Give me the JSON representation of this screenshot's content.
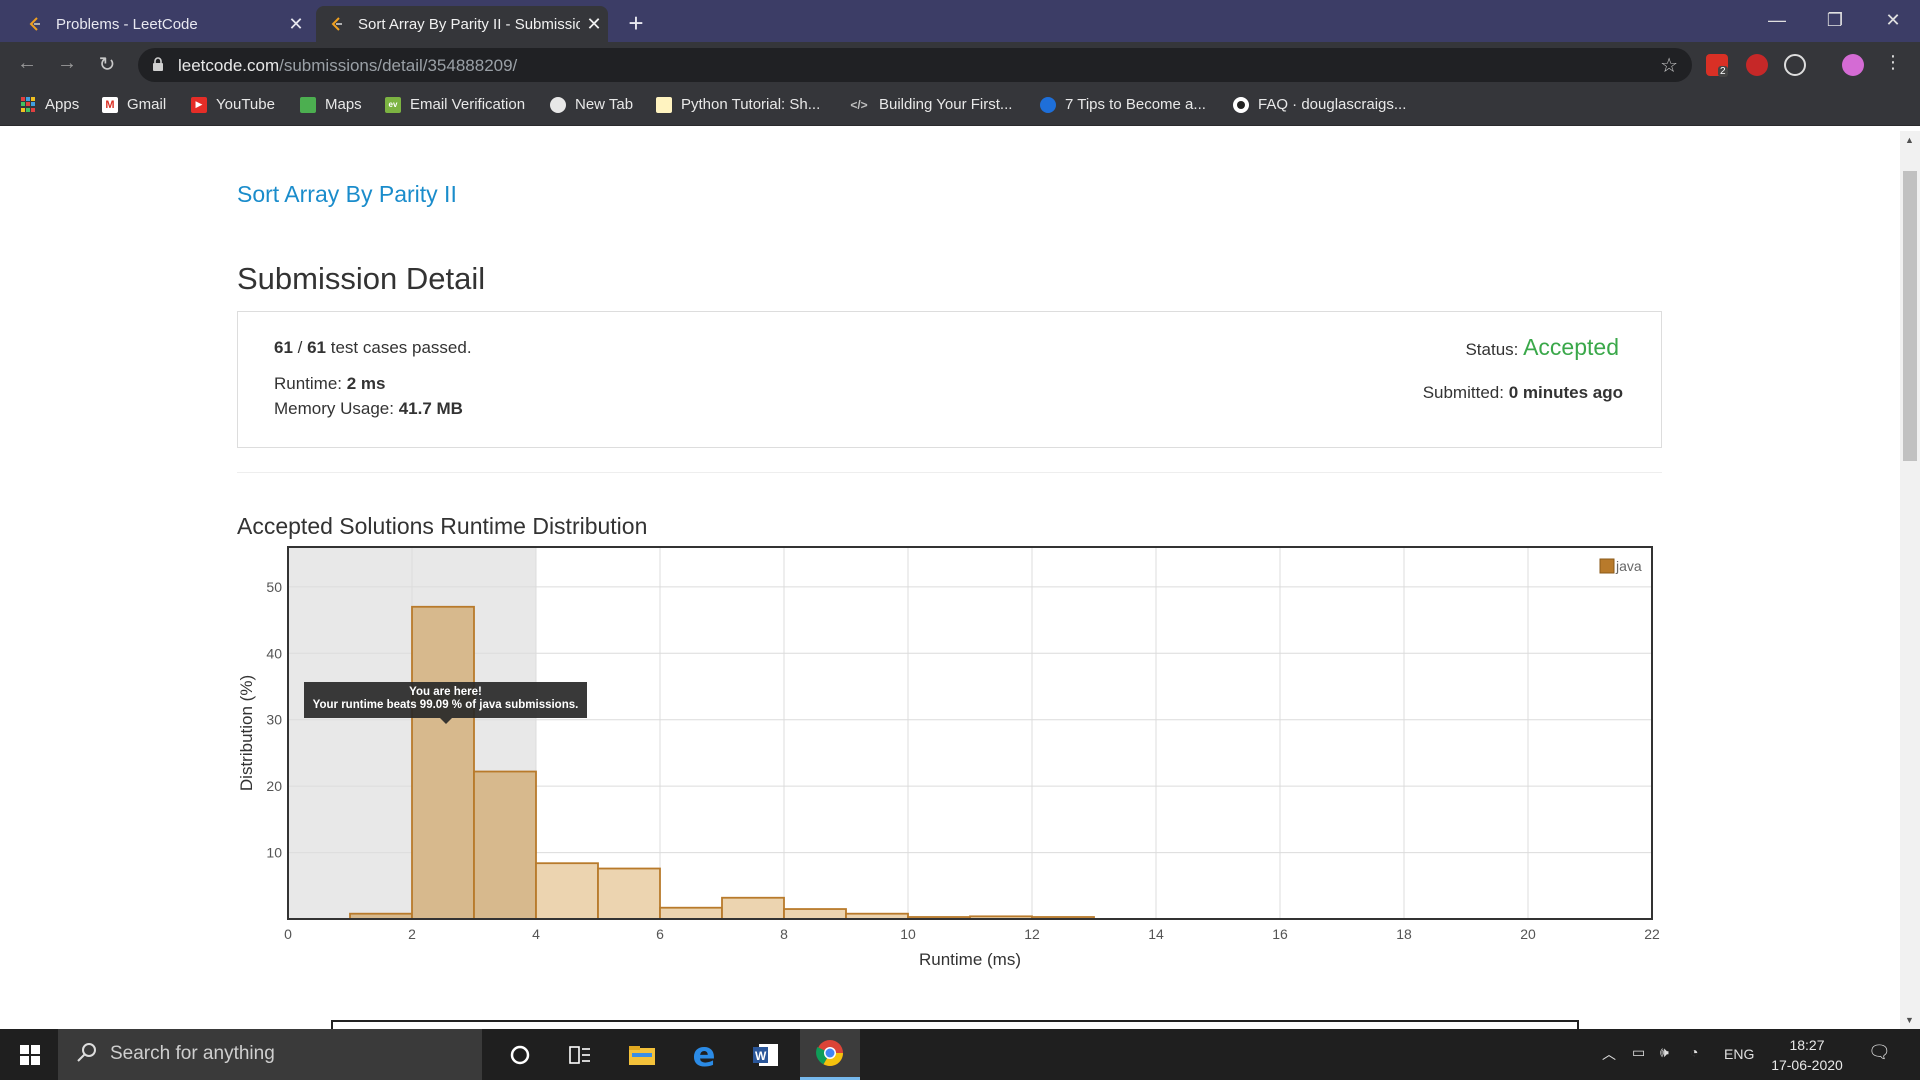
{
  "browser": {
    "tabs": [
      {
        "title": "Problems - LeetCode",
        "active": false
      },
      {
        "title": "Sort Array By Parity II - Submissio",
        "active": true
      }
    ],
    "url_host": "leetcode.com",
    "url_path": "/submissions/detail/354888209/",
    "extension_badge": "2",
    "bookmarks": [
      {
        "label": "Apps",
        "icon": "apps-grid-icon"
      },
      {
        "label": "Gmail",
        "icon": "gmail-icon"
      },
      {
        "label": "YouTube",
        "icon": "youtube-icon"
      },
      {
        "label": "Maps",
        "icon": "maps-icon"
      },
      {
        "label": "Email Verification",
        "icon": "email-verification-icon"
      },
      {
        "label": "New Tab",
        "icon": "globe-icon"
      },
      {
        "label": "Python Tutorial: Sh...",
        "icon": "python-tutorial-icon"
      },
      {
        "label": "Building Your First...",
        "icon": "code-icon"
      },
      {
        "label": "7 Tips to Become a...",
        "icon": "blue-circle-icon"
      },
      {
        "label": "FAQ · douglascraigs...",
        "icon": "github-icon"
      }
    ]
  },
  "page": {
    "problem_link": "Sort Array By Parity II",
    "heading": "Submission Detail",
    "tests_passed": "61",
    "tests_total": "61",
    "tests_suffix": " test cases passed.",
    "runtime_label": "Runtime: ",
    "runtime_value": "2 ms",
    "memory_label": "Memory Usage: ",
    "memory_value": "41.7 MB",
    "status_label": "Status: ",
    "status_value": "Accepted",
    "submitted_label": "Submitted: ",
    "submitted_value": "0 minutes ago",
    "distribution_heading": "Accepted Solutions Runtime Distribution",
    "tooltip_line1": "You are here!",
    "tooltip_line2": "Your runtime beats 99.09 % of java submissions."
  },
  "chart_data": {
    "type": "bar",
    "xlabel": "Runtime (ms)",
    "ylabel": "Distribution (%)",
    "xlim": [
      0,
      22
    ],
    "ylim": [
      0,
      56
    ],
    "xticks": [
      0,
      2,
      4,
      6,
      8,
      10,
      12,
      14,
      16,
      18,
      20,
      22
    ],
    "yticks": [
      10,
      20,
      30,
      40,
      50
    ],
    "legend": "top-right",
    "grid": true,
    "highlight_range": [
      0,
      4
    ],
    "series": [
      {
        "name": "java",
        "color": "#b87a2b",
        "bins": [
          {
            "x0": 1,
            "x1": 2,
            "value": 0.8,
            "highlight": true
          },
          {
            "x0": 2,
            "x1": 3,
            "value": 47.0,
            "highlight": true
          },
          {
            "x0": 3,
            "x1": 4,
            "value": 22.2,
            "highlight": true
          },
          {
            "x0": 4,
            "x1": 5,
            "value": 8.4,
            "highlight": false
          },
          {
            "x0": 5,
            "x1": 6,
            "value": 7.6,
            "highlight": false
          },
          {
            "x0": 6,
            "x1": 7,
            "value": 1.7,
            "highlight": false
          },
          {
            "x0": 7,
            "x1": 8,
            "value": 3.2,
            "highlight": false
          },
          {
            "x0": 8,
            "x1": 9,
            "value": 1.5,
            "highlight": false
          },
          {
            "x0": 9,
            "x1": 10,
            "value": 0.8,
            "highlight": false
          },
          {
            "x0": 10,
            "x1": 11,
            "value": 0.3,
            "highlight": false
          },
          {
            "x0": 11,
            "x1": 12,
            "value": 0.4,
            "highlight": false
          },
          {
            "x0": 12,
            "x1": 13,
            "value": 0.3,
            "highlight": false
          }
        ]
      }
    ]
  },
  "taskbar": {
    "search_placeholder": "Search for anything",
    "language": "ENG",
    "time": "18:27",
    "date": "17-06-2020"
  }
}
